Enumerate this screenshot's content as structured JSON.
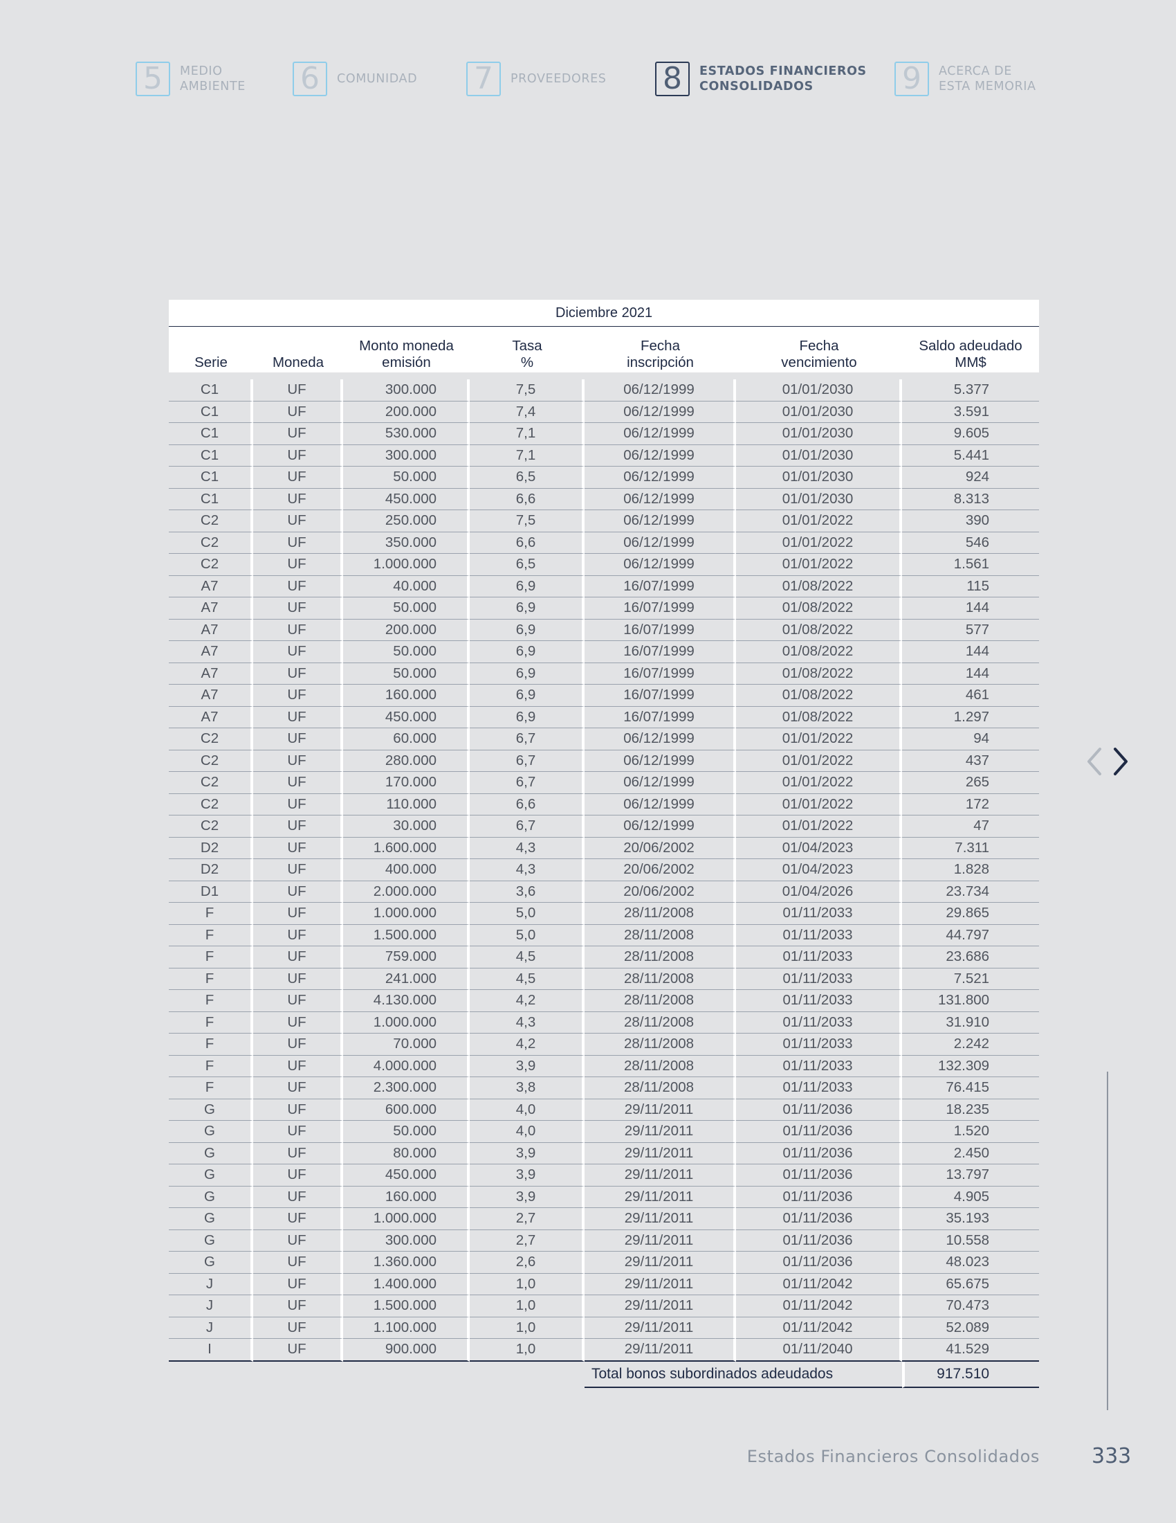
{
  "nav": {
    "chapters": [
      {
        "num": "5",
        "label": "MEDIO\nAMBIENTE"
      },
      {
        "num": "6",
        "label": "COMUNIDAD"
      },
      {
        "num": "7",
        "label": "PROVEEDORES"
      },
      {
        "num": "8",
        "label": "ESTADOS FINANCIEROS\nCONSOLIDADOS"
      },
      {
        "num": "9",
        "label": "ACERCA DE\nESTA MEMORIA"
      }
    ],
    "active_color": "#2b3a55",
    "inactive_border_color": "#8fcdea"
  },
  "table": {
    "period": "Diciembre 2021",
    "columns": [
      "Serie",
      "Moneda",
      "Monto moneda\nemisión",
      "Tasa\n%",
      "Fecha\ninscripción",
      "Fecha\nvencimiento",
      "Saldo adeudado\nMM$"
    ],
    "rows": [
      [
        "C1",
        "UF",
        "300.000",
        "7,5",
        "06/12/1999",
        "01/01/2030",
        "5.377"
      ],
      [
        "C1",
        "UF",
        "200.000",
        "7,4",
        "06/12/1999",
        "01/01/2030",
        "3.591"
      ],
      [
        "C1",
        "UF",
        "530.000",
        "7,1",
        "06/12/1999",
        "01/01/2030",
        "9.605"
      ],
      [
        "C1",
        "UF",
        "300.000",
        "7,1",
        "06/12/1999",
        "01/01/2030",
        "5.441"
      ],
      [
        "C1",
        "UF",
        "50.000",
        "6,5",
        "06/12/1999",
        "01/01/2030",
        "924"
      ],
      [
        "C1",
        "UF",
        "450.000",
        "6,6",
        "06/12/1999",
        "01/01/2030",
        "8.313"
      ],
      [
        "C2",
        "UF",
        "250.000",
        "7,5",
        "06/12/1999",
        "01/01/2022",
        "390"
      ],
      [
        "C2",
        "UF",
        "350.000",
        "6,6",
        "06/12/1999",
        "01/01/2022",
        "546"
      ],
      [
        "C2",
        "UF",
        "1.000.000",
        "6,5",
        "06/12/1999",
        "01/01/2022",
        "1.561"
      ],
      [
        "A7",
        "UF",
        "40.000",
        "6,9",
        "16/07/1999",
        "01/08/2022",
        "115"
      ],
      [
        "A7",
        "UF",
        "50.000",
        "6,9",
        "16/07/1999",
        "01/08/2022",
        "144"
      ],
      [
        "A7",
        "UF",
        "200.000",
        "6,9",
        "16/07/1999",
        "01/08/2022",
        "577"
      ],
      [
        "A7",
        "UF",
        "50.000",
        "6,9",
        "16/07/1999",
        "01/08/2022",
        "144"
      ],
      [
        "A7",
        "UF",
        "50.000",
        "6,9",
        "16/07/1999",
        "01/08/2022",
        "144"
      ],
      [
        "A7",
        "UF",
        "160.000",
        "6,9",
        "16/07/1999",
        "01/08/2022",
        "461"
      ],
      [
        "A7",
        "UF",
        "450.000",
        "6,9",
        "16/07/1999",
        "01/08/2022",
        "1.297"
      ],
      [
        "C2",
        "UF",
        "60.000",
        "6,7",
        "06/12/1999",
        "01/01/2022",
        "94"
      ],
      [
        "C2",
        "UF",
        "280.000",
        "6,7",
        "06/12/1999",
        "01/01/2022",
        "437"
      ],
      [
        "C2",
        "UF",
        "170.000",
        "6,7",
        "06/12/1999",
        "01/01/2022",
        "265"
      ],
      [
        "C2",
        "UF",
        "110.000",
        "6,6",
        "06/12/1999",
        "01/01/2022",
        "172"
      ],
      [
        "C2",
        "UF",
        "30.000",
        "6,7",
        "06/12/1999",
        "01/01/2022",
        "47"
      ],
      [
        "D2",
        "UF",
        "1.600.000",
        "4,3",
        "20/06/2002",
        "01/04/2023",
        "7.311"
      ],
      [
        "D2",
        "UF",
        "400.000",
        "4,3",
        "20/06/2002",
        "01/04/2023",
        "1.828"
      ],
      [
        "D1",
        "UF",
        "2.000.000",
        "3,6",
        "20/06/2002",
        "01/04/2026",
        "23.734"
      ],
      [
        "F",
        "UF",
        "1.000.000",
        "5,0",
        "28/11/2008",
        "01/11/2033",
        "29.865"
      ],
      [
        "F",
        "UF",
        "1.500.000",
        "5,0",
        "28/11/2008",
        "01/11/2033",
        "44.797"
      ],
      [
        "F",
        "UF",
        "759.000",
        "4,5",
        "28/11/2008",
        "01/11/2033",
        "23.686"
      ],
      [
        "F",
        "UF",
        "241.000",
        "4,5",
        "28/11/2008",
        "01/11/2033",
        "7.521"
      ],
      [
        "F",
        "UF",
        "4.130.000",
        "4,2",
        "28/11/2008",
        "01/11/2033",
        "131.800"
      ],
      [
        "F",
        "UF",
        "1.000.000",
        "4,3",
        "28/11/2008",
        "01/11/2033",
        "31.910"
      ],
      [
        "F",
        "UF",
        "70.000",
        "4,2",
        "28/11/2008",
        "01/11/2033",
        "2.242"
      ],
      [
        "F",
        "UF",
        "4.000.000",
        "3,9",
        "28/11/2008",
        "01/11/2033",
        "132.309"
      ],
      [
        "F",
        "UF",
        "2.300.000",
        "3,8",
        "28/11/2008",
        "01/11/2033",
        "76.415"
      ],
      [
        "G",
        "UF",
        "600.000",
        "4,0",
        "29/11/2011",
        "01/11/2036",
        "18.235"
      ],
      [
        "G",
        "UF",
        "50.000",
        "4,0",
        "29/11/2011",
        "01/11/2036",
        "1.520"
      ],
      [
        "G",
        "UF",
        "80.000",
        "3,9",
        "29/11/2011",
        "01/11/2036",
        "2.450"
      ],
      [
        "G",
        "UF",
        "450.000",
        "3,9",
        "29/11/2011",
        "01/11/2036",
        "13.797"
      ],
      [
        "G",
        "UF",
        "160.000",
        "3,9",
        "29/11/2011",
        "01/11/2036",
        "4.905"
      ],
      [
        "G",
        "UF",
        "1.000.000",
        "2,7",
        "29/11/2011",
        "01/11/2036",
        "35.193"
      ],
      [
        "G",
        "UF",
        "300.000",
        "2,7",
        "29/11/2011",
        "01/11/2036",
        "10.558"
      ],
      [
        "G",
        "UF",
        "1.360.000",
        "2,6",
        "29/11/2011",
        "01/11/2036",
        "48.023"
      ],
      [
        "J",
        "UF",
        "1.400.000",
        "1,0",
        "29/11/2011",
        "01/11/2042",
        "65.675"
      ],
      [
        "J",
        "UF",
        "1.500.000",
        "1,0",
        "29/11/2011",
        "01/11/2042",
        "70.473"
      ],
      [
        "J",
        "UF",
        "1.100.000",
        "1,0",
        "29/11/2011",
        "01/11/2042",
        "52.089"
      ],
      [
        "I",
        "UF",
        "900.000",
        "1,0",
        "29/11/2011",
        "01/11/2040",
        "41.529"
      ]
    ],
    "total_label": "Total bonos subordinados adeudados",
    "total_value": "917.510"
  },
  "pager": {
    "prev_icon": "chevron-left-icon",
    "next_icon": "chevron-right-icon"
  },
  "footer": {
    "title": "Estados Financieros Consolidados",
    "page_number": "333"
  }
}
